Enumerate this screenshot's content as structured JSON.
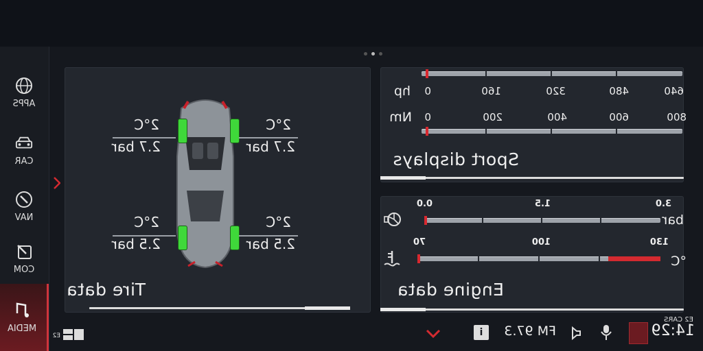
{
  "sidebar": {
    "items": [
      {
        "label": "APPS",
        "icon": "globe-icon",
        "active": false
      },
      {
        "label": "CAR",
        "icon": "car-front-icon",
        "active": false
      },
      {
        "label": "NAV",
        "icon": "compass-icon",
        "active": false
      },
      {
        "label": "COM",
        "icon": "edit-icon",
        "active": false
      },
      {
        "label": "MEDIA",
        "icon": "music-note-icon",
        "active": true
      }
    ]
  },
  "panels": {
    "tire": {
      "title": "Tire data",
      "front_left": {
        "temp": "2°C",
        "pressure": "2.7 bar"
      },
      "front_right": {
        "temp": "2°C",
        "pressure": "2.7 bar"
      },
      "rear_left": {
        "temp": "2°C",
        "pressure": "2.5 bar"
      },
      "rear_right": {
        "temp": "2°C",
        "pressure": "2.5 bar"
      }
    },
    "sport": {
      "title": "Sport displays",
      "hp": {
        "unit": "hp",
        "ticks": [
          "0",
          "160",
          "320",
          "480",
          "640"
        ],
        "value_fraction": 0
      },
      "nm": {
        "unit": "Nm",
        "ticks": [
          "0",
          "200",
          "400",
          "600",
          "800"
        ],
        "value_fraction": 0
      }
    },
    "engine": {
      "title": "Engine data",
      "boost": {
        "unit": "bar",
        "ticks": [
          "0.0",
          "1.5",
          "3.0"
        ],
        "value_fraction": 0
      },
      "oil": {
        "unit": "°C",
        "ticks": [
          "70",
          "100",
          "130"
        ],
        "value_fraction": 0
      }
    }
  },
  "status": {
    "time": "14:29",
    "brand": "E2 CARS",
    "radio": "FM 97.3",
    "info_badge": "i",
    "layout_label": "E2"
  },
  "colors": {
    "accent": "#d42a30",
    "wheel": "#3fd83a"
  }
}
